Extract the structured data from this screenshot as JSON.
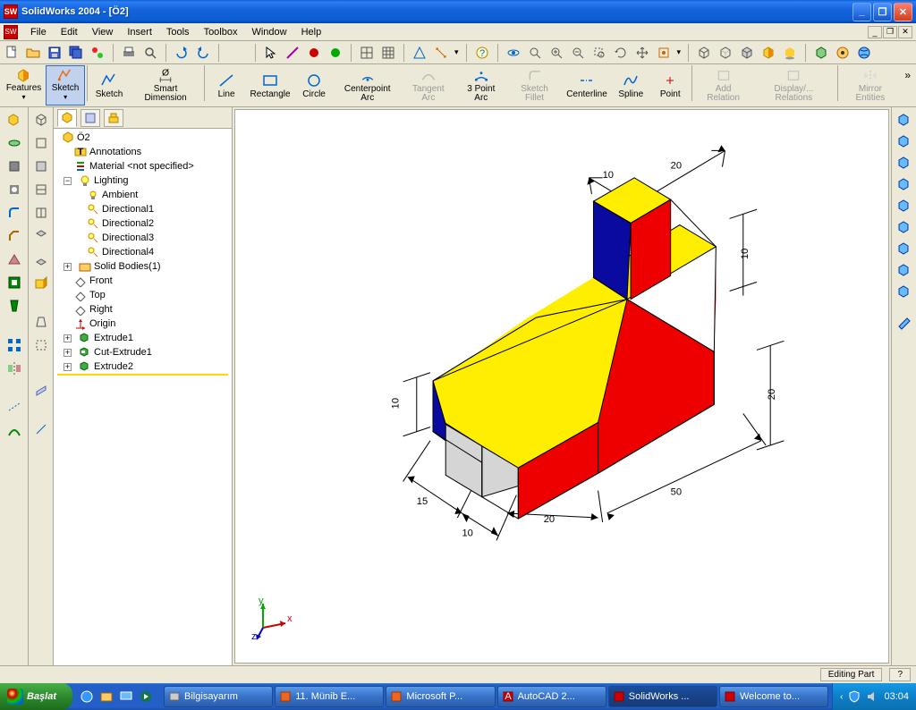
{
  "title": "SolidWorks 2004 - [Ö2]",
  "menu": [
    "File",
    "Edit",
    "View",
    "Insert",
    "Tools",
    "Toolbox",
    "Window",
    "Help"
  ],
  "commands": {
    "features": "Features",
    "sketch": "Sketch",
    "sketch2": "Sketch",
    "smartdim": "Smart Dimension",
    "line": "Line",
    "rect": "Rectangle",
    "circle": "Circle",
    "cparc": "Centerpoint Arc",
    "tangent": "Tangent Arc",
    "threept": "3 Point Arc",
    "sfillet": "Sketch Fillet",
    "cline": "Centerline",
    "spline": "Spline",
    "point": "Point",
    "addrel": "Add Relation",
    "disprel": "Display/... Relations",
    "mirror": "Mirror Entities"
  },
  "tree": {
    "root": "Ö2",
    "annotations": "Annotations",
    "material": "Material <not specified>",
    "lighting": "Lighting",
    "ambient": "Ambient",
    "dir1": "Directional1",
    "dir2": "Directional2",
    "dir3": "Directional3",
    "dir4": "Directional4",
    "solid": "Solid Bodies(1)",
    "front": "Front",
    "top": "Top",
    "right": "Right",
    "origin": "Origin",
    "ext1": "Extrude1",
    "cutext1": "Cut-Extrude1",
    "ext2": "Extrude2"
  },
  "dims": {
    "d10a": "10",
    "d20a": "20",
    "d10b": "10",
    "d10c": "10",
    "d20b": "20",
    "d15": "15",
    "d10d": "10",
    "d20c": "20",
    "d50": "50"
  },
  "status": "Editing Part",
  "taskbar": {
    "start": "Başlat",
    "t1": "Bilgisayarım",
    "t2": "11. Münib E...",
    "t3": "Microsoft P...",
    "t4": "AutoCAD 2...",
    "t5": "SolidWorks ...",
    "t6": "Welcome to...",
    "clock": "03:04"
  },
  "triad": {
    "x": "x",
    "y": "y",
    "z": "z"
  }
}
